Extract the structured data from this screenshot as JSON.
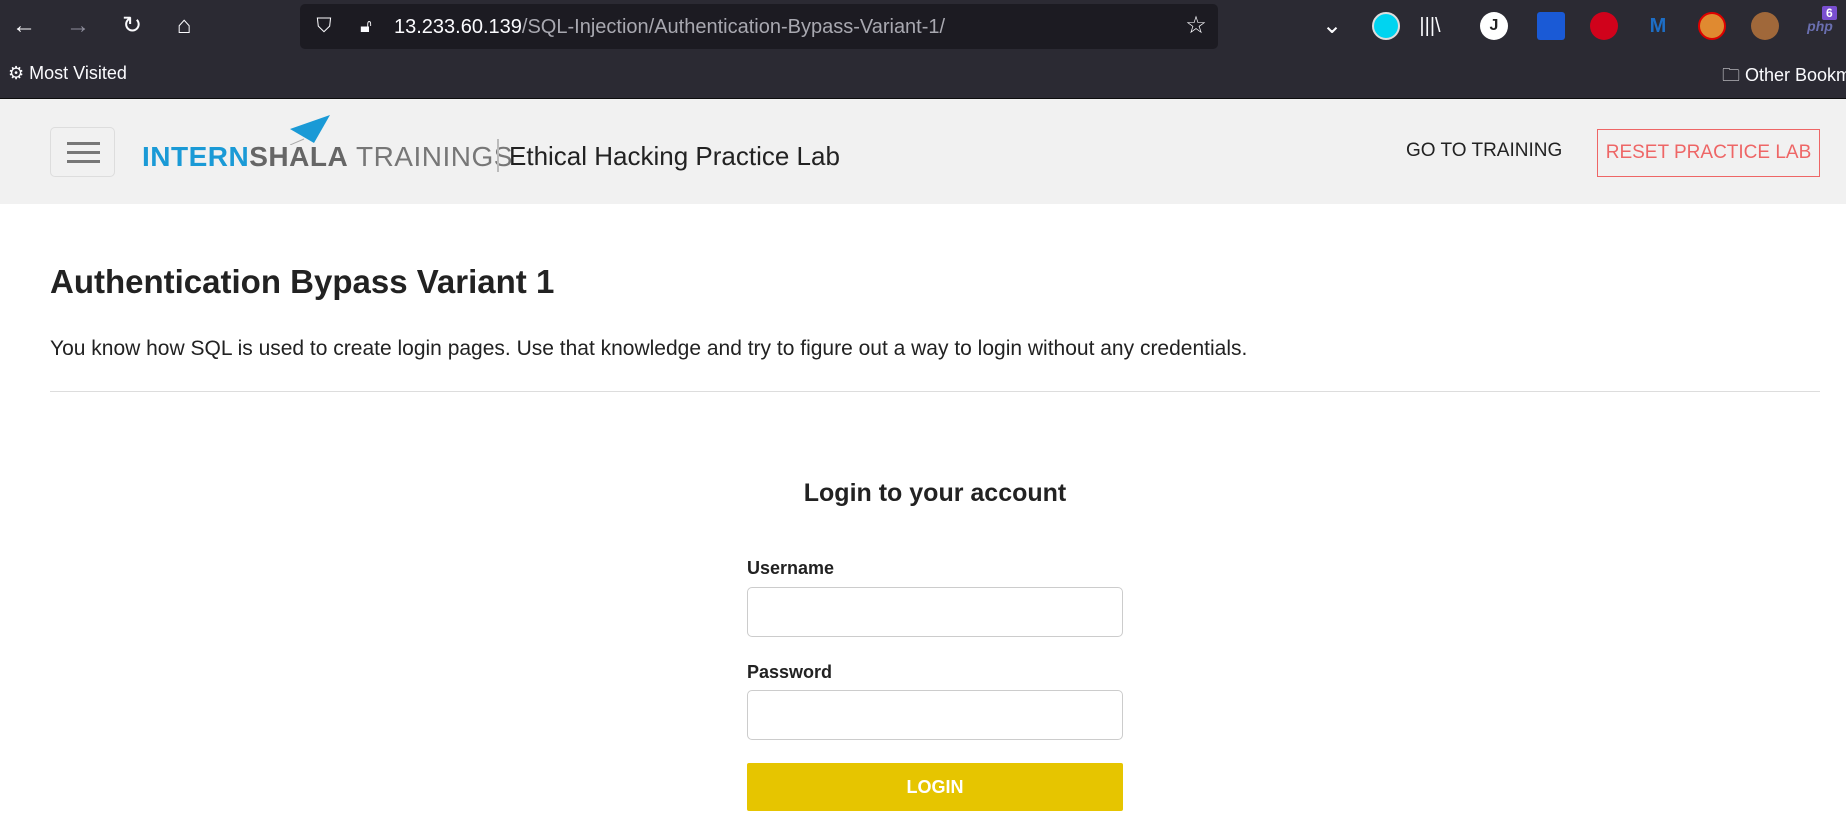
{
  "browser": {
    "url_host": "13.233.60.139",
    "url_path": "/SQL-Injection/Authentication-Bypass-Variant-1/",
    "bookmarks": {
      "most_visited": "Most Visited",
      "other": "Other Bookmarks"
    },
    "php_badge": "6",
    "ext_j": "J"
  },
  "header": {
    "logo_intern": "INTERN",
    "logo_shala": "SHALA",
    "logo_trainings": " TRAININGS",
    "lab_title": "Ethical Hacking Practice Lab",
    "go_training": "GO TO TRAINING",
    "reset": "RESET PRACTICE LAB"
  },
  "page": {
    "title": "Authentication Bypass Variant 1",
    "description": "You know how SQL is used to create login pages. Use that knowledge and try to figure out a way to login without any credentials."
  },
  "login": {
    "heading": "Login to your account",
    "username_label": "Username",
    "username_value": "",
    "password_label": "Password",
    "password_value": "",
    "button": "LOGIN"
  },
  "colors": {
    "accent": "#1a9ad6",
    "button": "#e6c500",
    "reset": "#ee6666"
  }
}
